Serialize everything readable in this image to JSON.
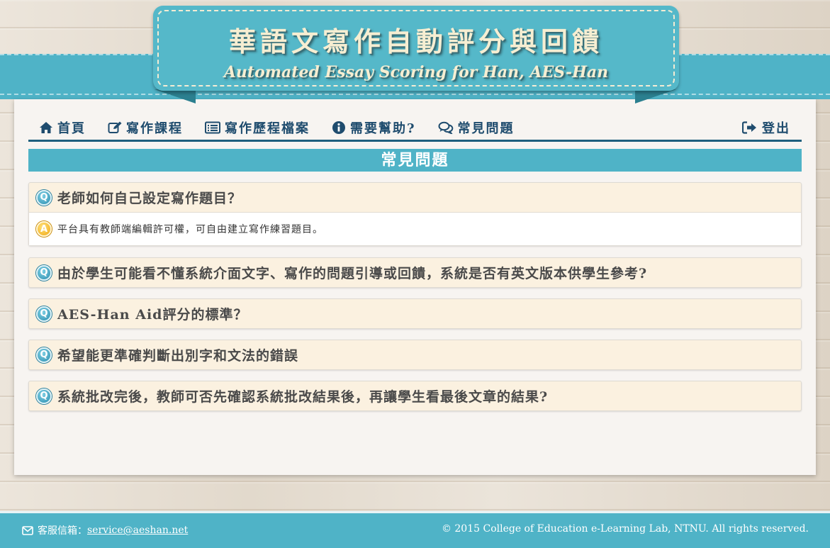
{
  "header": {
    "title": "華語文寫作自動評分與回饋",
    "subtitle": "Automated Essay Scoring for Han, AES-Han"
  },
  "nav": {
    "home": "首頁",
    "course": "寫作課程",
    "portfolio": "寫作歷程檔案",
    "help": "需要幫助?",
    "faq": "常見問題",
    "logout": "登出"
  },
  "page": {
    "section_title": "常見問題"
  },
  "faq": [
    {
      "q_badge": "Q",
      "question": "老師如何自己設定寫作題目？",
      "a_badge": "A",
      "answer": "平台具有教師端編輯許可權，可自由建立寫作練習題目。",
      "expanded": true
    },
    {
      "q_badge": "Q",
      "question": "由於學生可能看不懂系統介面文字、寫作的問題引導或回饋，系統是否有英文版本供學生參考?",
      "expanded": false
    },
    {
      "q_badge": "Q",
      "question": "AES-Han Aid評分的標準？",
      "expanded": false
    },
    {
      "q_badge": "Q",
      "question": "希望能更準確判斷出別字和文法的錯誤",
      "expanded": false
    },
    {
      "q_badge": "Q",
      "question": "系統批改完後，教師可否先確認系統批改結果後，再讓學生看最後文章的結果?",
      "expanded": false
    }
  ],
  "footer": {
    "contact_label": "客服信箱：",
    "email": "service@aeshan.net",
    "copyright": "© 2015 College of Education e-Learning Lab, NTNU. All rights reserved."
  },
  "colors": {
    "teal": "#4fb3c7",
    "navy": "#1f4c6e",
    "card": "#fbf1e0",
    "cream_text": "#f6eed2"
  },
  "icons": [
    "home-icon",
    "edit-icon",
    "list-icon",
    "info-icon",
    "comments-icon",
    "logout-icon",
    "envelope-icon",
    "q-badge-icon",
    "a-badge-icon"
  ]
}
